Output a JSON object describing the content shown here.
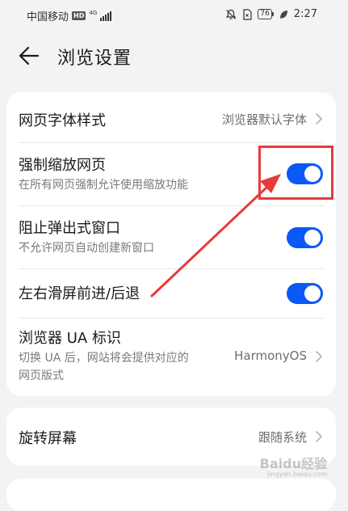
{
  "status_bar": {
    "carrier": "中国移动",
    "hd": "HD",
    "network": "4G",
    "battery": "76",
    "time": "2:27"
  },
  "header": {
    "title": "浏览设置",
    "back_icon": "arrow-left-icon"
  },
  "settings": {
    "font_style": {
      "title": "网页字体样式",
      "value": "浏览器默认字体"
    },
    "force_zoom": {
      "title": "强制缩放网页",
      "subtitle": "在所有网页强制允许使用缩放功能",
      "enabled": true
    },
    "block_popups": {
      "title": "阻止弹出式窗口",
      "subtitle": "不允许网页自动创建新窗口",
      "enabled": true
    },
    "swipe_nav": {
      "title": "左右滑屏前进/后退",
      "enabled": true
    },
    "ua": {
      "title": "浏览器 UA 标识",
      "subtitle_line1": "切换 UA 后，网站将会提供对应的",
      "subtitle_line2": "网页版式",
      "value": "HarmonyOS"
    }
  },
  "rotation": {
    "title": "旋转屏幕",
    "value": "跟随系统"
  },
  "colors": {
    "accent": "#0a59f7",
    "annotation": "#e83a3a",
    "background": "#f1f3f5"
  },
  "watermark": {
    "text": "Baidu经验",
    "sub": "jingyan.baidu.com"
  }
}
